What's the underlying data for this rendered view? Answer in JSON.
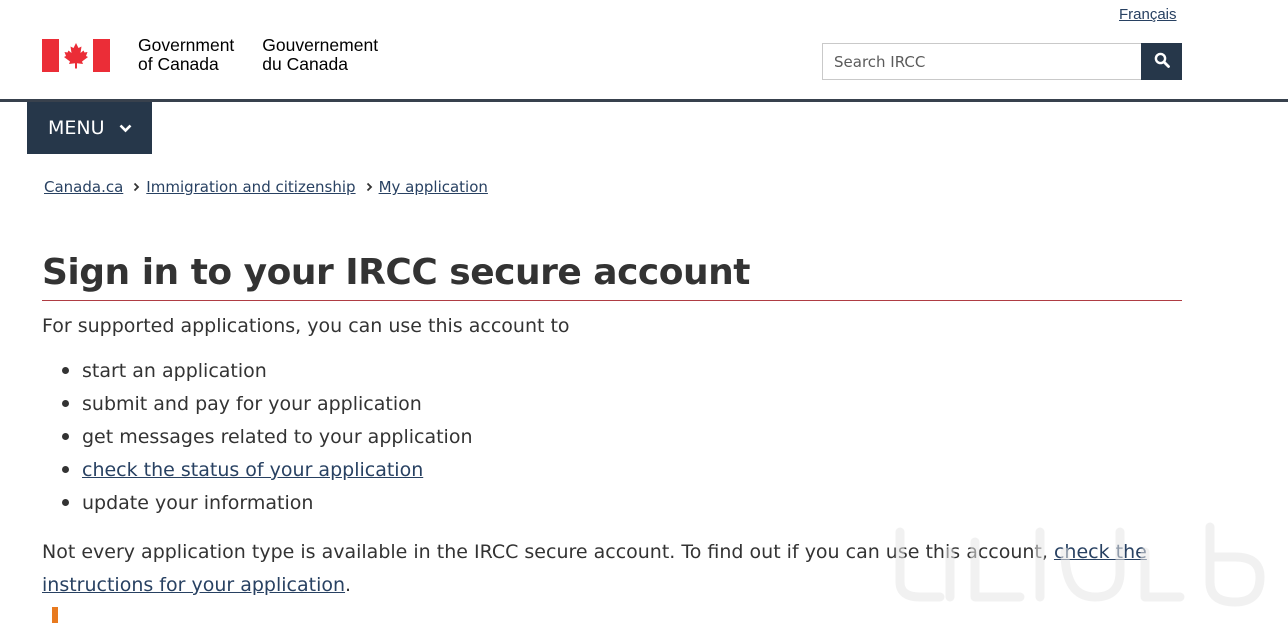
{
  "header": {
    "language_link": "Français",
    "wordmark_en_line1": "Government",
    "wordmark_en_line2": "of Canada",
    "wordmark_fr_line1": "Gouvernement",
    "wordmark_fr_line2": "du Canada",
    "search_placeholder": "Search IRCC",
    "search_icon": "search-icon",
    "flag_icon": "canada-flag-icon"
  },
  "menu": {
    "label": "MENU",
    "icon": "chevron-down-icon"
  },
  "breadcrumb": [
    {
      "label": "Canada.ca"
    },
    {
      "label": "Immigration and citizenship"
    },
    {
      "label": "My application"
    }
  ],
  "main": {
    "title": "Sign in to your IRCC secure account",
    "intro": "For supported applications, you can use this account to",
    "features": [
      {
        "text": "start an application",
        "link": false
      },
      {
        "text": "submit and pay for your application",
        "link": false
      },
      {
        "text": "get messages related to your application",
        "link": false
      },
      {
        "text": "check the status of your application",
        "link": true
      },
      {
        "text": "update your information",
        "link": false
      }
    ],
    "note_text": "Not every application type is available in the IRCC secure account. To find out if you can use this account, ",
    "note_link": "check the instructions for your application",
    "note_end": "."
  },
  "colors": {
    "brand_dark": "#26374a",
    "link": "#284162",
    "flag_red": "#eb2d37",
    "title_rule": "#af3c43"
  }
}
